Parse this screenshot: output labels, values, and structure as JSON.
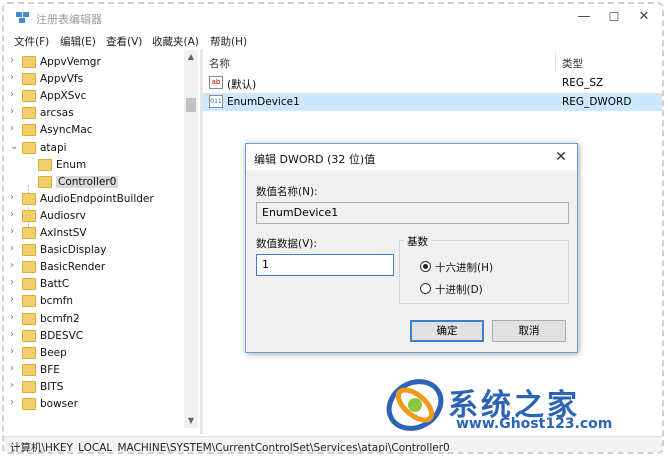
{
  "window": {
    "title": "注册表编辑器",
    "minimize": "—",
    "maximize": "☐",
    "close": "✕"
  },
  "menu": [
    "文件(F)",
    "编辑(E)",
    "查看(V)",
    "收藏夹(A)",
    "帮助(H)"
  ],
  "tree": {
    "items": [
      {
        "label": "AppvVemgr",
        "expanded": false
      },
      {
        "label": "AppvVfs",
        "expanded": false
      },
      {
        "label": "AppXSvc",
        "expanded": false
      },
      {
        "label": "arcsas",
        "expanded": false
      },
      {
        "label": "AsyncMac",
        "expanded": false
      },
      {
        "label": "atapi",
        "expanded": true
      },
      {
        "label": "Enum",
        "expanded": false
      },
      {
        "label": "Controller0",
        "expanded": false
      },
      {
        "label": "AudioEndpointBuilder",
        "expanded": false
      },
      {
        "label": "Audiosrv",
        "expanded": false
      },
      {
        "label": "AxInstSV",
        "expanded": false
      },
      {
        "label": "BasicDisplay",
        "expanded": false
      },
      {
        "label": "BasicRender",
        "expanded": false
      },
      {
        "label": "BattC",
        "expanded": false
      },
      {
        "label": "bcmfn",
        "expanded": false
      },
      {
        "label": "bcmfn2",
        "expanded": false
      },
      {
        "label": "BDESVC",
        "expanded": false
      },
      {
        "label": "Beep",
        "expanded": false
      },
      {
        "label": "BFE",
        "expanded": false
      },
      {
        "label": "BITS",
        "expanded": false
      },
      {
        "label": "bowser",
        "expanded": false
      }
    ],
    "selected": "Controller0"
  },
  "list": {
    "columns": {
      "name": "名称",
      "type": "类型"
    },
    "rows": [
      {
        "icon": "ab",
        "name": "(默认)",
        "type": "REG_SZ"
      },
      {
        "icon": "011",
        "name": "EnumDevice1",
        "type": "REG_DWORD"
      }
    ]
  },
  "status": {
    "path": "计算机\\HKEY_LOCAL_MACHINE\\SYSTEM\\CurrentControlSet\\Services\\atapi\\Controller0"
  },
  "dialog": {
    "title": "编辑 DWORD (32 位)值",
    "name_label": "数值名称(N):",
    "name_value": "EnumDevice1",
    "data_label": "数值数据(V):",
    "data_value": "1",
    "base_label": "基数",
    "radio_hex": "十六进制(H)",
    "radio_dec": "十进制(D)",
    "selected_base": "hex",
    "ok": "确定",
    "cancel": "取消",
    "close": "✕"
  },
  "watermark": {
    "title": "系统之家",
    "url": "www.Ghost123.com"
  },
  "colors": {
    "selection": "#cce8ff",
    "accent": "#3c7fd1",
    "folder": "#f3cf6b",
    "watermark": "#2b63b8"
  }
}
